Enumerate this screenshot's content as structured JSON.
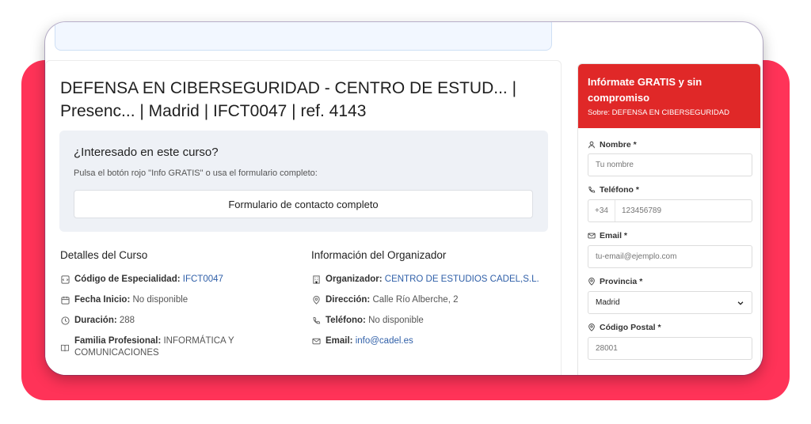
{
  "course": {
    "title": "DEFENSA EN CIBERSEGURIDAD - CENTRO DE ESTUD... | Presenc... | Madrid | IFCT0047 | ref. 4143"
  },
  "interest": {
    "title": "¿Interesado en este curso?",
    "subtitle": "Pulsa el botón rojo \"Info GRATIS\" o usa el formulario completo:",
    "button_label": "Formulario de contacto completo"
  },
  "details": {
    "heading": "Detalles del Curso",
    "items": [
      {
        "label": "Código de Especialidad:",
        "value": "IFCT0047",
        "link": true
      },
      {
        "label": "Fecha Inicio:",
        "value": "No disponible",
        "link": false
      },
      {
        "label": "Duración:",
        "value": "288",
        "link": false
      },
      {
        "label": "Familia Profesional:",
        "value": "INFORMÁTICA Y COMUNICACIONES",
        "link": false
      }
    ]
  },
  "organizer": {
    "heading": "Información del Organizador",
    "items": [
      {
        "label": "Organizador:",
        "value": "CENTRO DE ESTUDIOS CADEL,S.L.",
        "link": true
      },
      {
        "label": "Dirección:",
        "value": "Calle Río Alberche, 2",
        "link": false
      },
      {
        "label": "Teléfono:",
        "value": "No disponible",
        "link": false
      },
      {
        "label": "Email:",
        "value": "info@cadel.es",
        "link": true
      }
    ]
  },
  "form": {
    "title": "Infórmate GRATIS y sin compromiso",
    "subtitle": "Sobre: DEFENSA EN CIBERSEGURIDAD",
    "name_label": "Nombre *",
    "name_placeholder": "Tu nombre",
    "phone_label": "Teléfono *",
    "phone_prefix": "+34",
    "phone_placeholder": "123456789",
    "email_label": "Email *",
    "email_placeholder": "tu-email@ejemplo.com",
    "province_label": "Provincia *",
    "province_value": "Madrid",
    "postal_label": "Código Postal *",
    "postal_placeholder": "28001"
  },
  "colors": {
    "accent_red": "#e02828",
    "backdrop_pink": "#ff3358",
    "link_blue": "#2f5fa8"
  }
}
